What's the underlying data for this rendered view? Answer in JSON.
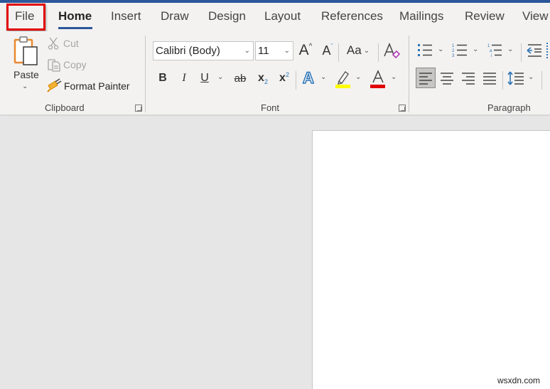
{
  "tabs": [
    {
      "label": "File",
      "active": false,
      "highlighted": true
    },
    {
      "label": "Home",
      "active": true
    },
    {
      "label": "Insert",
      "active": false
    },
    {
      "label": "Draw",
      "active": false
    },
    {
      "label": "Design",
      "active": false
    },
    {
      "label": "Layout",
      "active": false
    },
    {
      "label": "References",
      "active": false
    },
    {
      "label": "Mailings",
      "active": false
    },
    {
      "label": "Review",
      "active": false
    },
    {
      "label": "View",
      "active": false
    }
  ],
  "clipboard": {
    "label": "Clipboard",
    "paste": "Paste",
    "cut": "Cut",
    "copy": "Copy",
    "format_painter": "Format Painter"
  },
  "font": {
    "label": "Font",
    "font_name": "Calibri (Body)",
    "font_size": "11",
    "grow_icon": "A",
    "shrink_icon": "A",
    "change_case": "Aa",
    "bold": "B",
    "italic": "I",
    "underline": "U",
    "strikethrough": "ab",
    "subscript": "x",
    "superscript": "x",
    "text_effects": "A",
    "font_color": "A",
    "highlight_color": "#ffff00",
    "font_color_value": "#e00000"
  },
  "paragraph": {
    "label": "Paragraph"
  },
  "colors": {
    "accent": "#2b579a",
    "file_highlight_border": "#e00000",
    "icon_blue": "#2e75b6"
  },
  "watermark": "wsxdn.com"
}
